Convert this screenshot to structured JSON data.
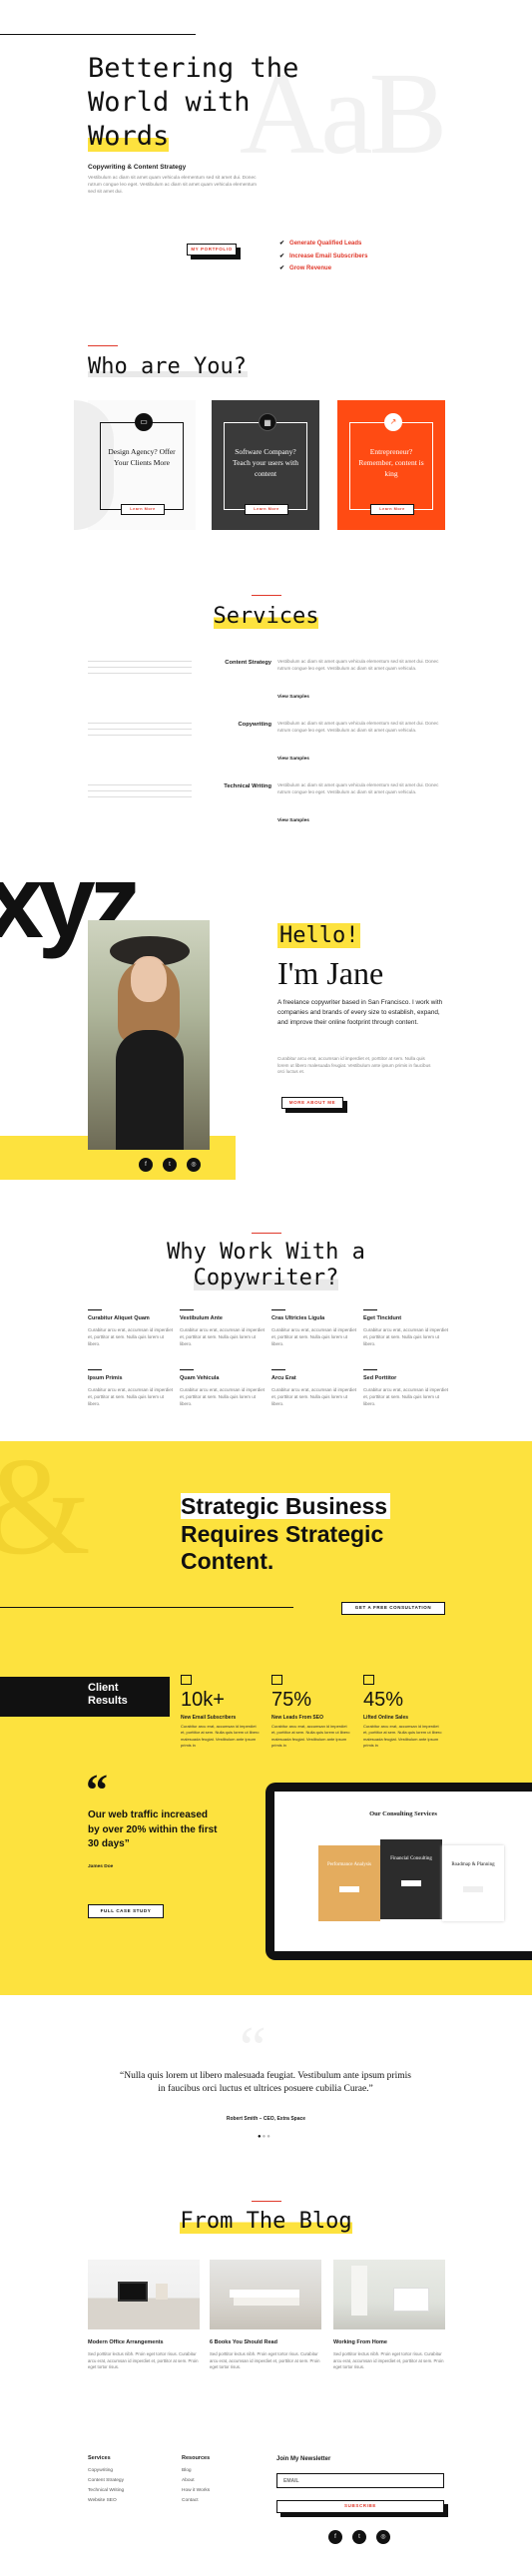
{
  "hero": {
    "title_l1": "Bettering the",
    "title_l2": "World with",
    "title_l3": "Words",
    "bg_letters": "AaB",
    "subtitle": "Copywriting & Content Strategy",
    "body": "Vestibulum ac diam sit amet quam vehicula elementum sed sit amet dui. Donec rutrum congue leo eget. Vestibulum ac diam sit amet quam vehicula elementum sed sit amet dui.",
    "button": "My Portfolio",
    "checks": [
      "Generate Qualified Leads",
      "Increase Email Subscribers",
      "Grow Revenue"
    ]
  },
  "who": {
    "title": "Who are You?",
    "cards": [
      {
        "title": "Design Agency? Offer Your Clients More",
        "button": "Learn More",
        "icon": "computer-icon"
      },
      {
        "title": "Software Company? Teach your users with content",
        "button": "Learn More",
        "icon": "grid-icon"
      },
      {
        "title": "Entrepreneur? Remember, content is king",
        "button": "Learn More",
        "icon": "chart-icon"
      }
    ]
  },
  "services": {
    "title": "Services",
    "items": [
      {
        "name": "Content Strategy",
        "desc": "Vestibulum ac diam sit amet quam vehicula elementum sed sit amet dui. Donec rutrum congue leo eget. Vestibulum ac diam sit amet quam vehicula.",
        "link": "View Samples"
      },
      {
        "name": "Copywriting",
        "desc": "Vestibulum ac diam sit amet quam vehicula elementum sed sit amet dui. Donec rutrum congue leo eget. Vestibulum ac diam sit amet quam vehicula.",
        "link": "View Samples"
      },
      {
        "name": "Technical Writing",
        "desc": "Vestibulum ac diam sit amet quam vehicula elementum sed sit amet dui. Donec rutrum congue leo eget. Vestibulum ac diam sit amet quam vehicula.",
        "link": "View Samples"
      }
    ]
  },
  "about": {
    "bg_text": "xyz",
    "hello": "Hello!",
    "name": "I'm Jane",
    "lead": "A freelance copywriter based in San Francisco. I work with companies and brands of every size to establish, expand, and improve their online footprint through content.",
    "body": "Curabitur arcu erat, accumsan id imperdiet et, porttitor at sem. Nulla quis lorem ut libero malesuada feugiat. Vestibulum ante ipsum primis in faucibus orci luctus et.",
    "button": "More About Me"
  },
  "why": {
    "title_l1": "Why Work With a",
    "title_l2": "Copywriter?",
    "items": [
      {
        "t": "Curabitur Aliquet Quam",
        "d": "Curabitur arcu erat, accumsan id imperdiet et, porttitor at sem. Nulla quis lorem ut libero."
      },
      {
        "t": "Vestibulum Ante",
        "d": "Curabitur arcu erat, accumsan id imperdiet et, porttitor at sem. Nulla quis lorem ut libero."
      },
      {
        "t": "Cras Ultricies Ligula",
        "d": "Curabitur arcu erat, accumsan id imperdiet et, porttitor at sem. Nulla quis lorem ut libero."
      },
      {
        "t": "Eget Tincidunt",
        "d": "Curabitur arcu erat, accumsan id imperdiet et, porttitor at sem. Nulla quis lorem ut libero."
      },
      {
        "t": "Ipsum Primis",
        "d": "Curabitur arcu erat, accumsan id imperdiet et, porttitor at sem. Nulla quis lorem ut libero."
      },
      {
        "t": "Quam Vehicula",
        "d": "Curabitur arcu erat, accumsan id imperdiet et, porttitor at sem. Nulla quis lorem ut libero."
      },
      {
        "t": "Arcu Erat",
        "d": "Curabitur arcu erat, accumsan id imperdiet et, porttitor at sem. Nulla quis lorem ut libero."
      },
      {
        "t": "Sed Porttitor",
        "d": "Curabitur arcu erat, accumsan id imperdiet et, porttitor at sem. Nulla quis lorem ut libero."
      }
    ]
  },
  "strategy": {
    "title_l1": "Strategic Business",
    "title_l2": "Requires Strategic",
    "title_l3": "Content.",
    "button": "Get a Free Consultation"
  },
  "results": {
    "label_l1": "Client",
    "label_l2": "Results",
    "stats": [
      {
        "num": "10k+",
        "lbl": "New Email Subscribers",
        "d": "Curabitur arcu erat, accumsan id imperdiet et, porttitor at sem. Nulla quis lorem ut libero malesuada feugiat. Vestibulum ante ipsum primis in"
      },
      {
        "num": "75%",
        "lbl": "New Leads From SEO",
        "d": "Curabitur arcu erat, accumsan id imperdiet et, porttitor at sem. Nulla quis lorem ut libero malesuada feugiat. Vestibulum ante ipsum primis in"
      },
      {
        "num": "45%",
        "lbl": "Lifted Online Sales",
        "d": "Curabitur arcu erat, accumsan id imperdiet et, porttitor at sem. Nulla quis lorem ut libero malesuada feugiat. Vestibulum ante ipsum primis in"
      }
    ],
    "quote_mark": "“",
    "quote": "Our web traffic increased by over 20% within the first 30 days”",
    "quote_author": "James Doe",
    "button": "Full Case Study",
    "laptop_title": "Our Consulting Services",
    "laptop_cards": [
      "Performance Analysis",
      "Financial Consulting",
      "Roadmap & Planning"
    ]
  },
  "testimonial": {
    "text": "“Nulla quis lorem ut libero malesuada feugiat. Vestibulum ante ipsum primis in faucibus orci luctus et ultrices posuere cubilia Curae.”",
    "author": "Robert Smith – CEO, Extra Space"
  },
  "blog": {
    "title": "From The Blog",
    "posts": [
      {
        "t": "Modern Office Arrangements",
        "d": "Sed porttitor lectus nibh. Proin eget tortor risus. Curabitur arcu erat, accumsan id imperdiet et, porttitor at sem. Proin eget tortor risus."
      },
      {
        "t": "6 Books You Should Read",
        "d": "Sed porttitor lectus nibh. Proin eget tortor risus. Curabitur arcu erat, accumsan id imperdiet et, porttitor at sem. Proin eget tortor risus."
      },
      {
        "t": "Working From Home",
        "d": "Sed porttitor lectus nibh. Proin eget tortor risus. Curabitur arcu erat, accumsan id imperdiet et, porttitor at sem. Proin eget tortor risus."
      }
    ]
  },
  "footer": {
    "services_head": "Services",
    "services": [
      "Copywriting",
      "Content Strategy",
      "Technical Writing",
      "Website SEO"
    ],
    "resources_head": "Resources",
    "resources": [
      "Blog",
      "About",
      "How it Works",
      "Contact"
    ],
    "newsletter_head": "Join My Newsletter",
    "email_placeholder": "EMAIL",
    "subscribe": "Subscribe"
  },
  "colors": {
    "accent": "#fde23e",
    "red": "#e0392b",
    "orange": "#ff4b13",
    "dark": "#111111"
  }
}
